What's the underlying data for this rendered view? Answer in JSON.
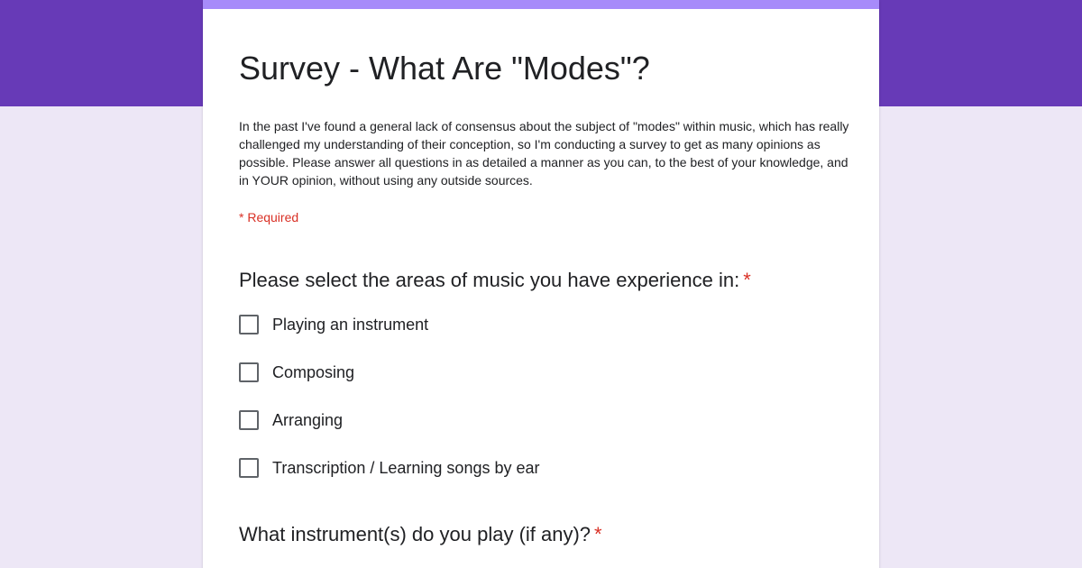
{
  "theme": {
    "header_color": "#673ab7",
    "accent_strip_color": "#a78bfa",
    "background_color": "#ede7f6",
    "required_color": "#d93025"
  },
  "form": {
    "title": "Survey - What Are \"Modes\"?",
    "description": "In the past I've found a general lack of consensus about the subject of \"modes\" within music, which has really challenged my understanding of their conception, so I'm conducting a survey to get as many opinions as possible. Please answer all questions in as detailed a manner as you can, to the best of your knowledge, and in YOUR opinion, without using any outside sources.",
    "required_note": "* Required"
  },
  "questions": [
    {
      "text": "Please select the areas of music you have experience in:",
      "required_marker": "*",
      "type": "checkbox",
      "options": [
        {
          "label": "Playing an instrument",
          "checked": false
        },
        {
          "label": "Composing",
          "checked": false
        },
        {
          "label": "Arranging",
          "checked": false
        },
        {
          "label": "Transcription / Learning songs by ear",
          "checked": false
        }
      ]
    },
    {
      "text": "What instrument(s) do you play (if any)?",
      "required_marker": "*"
    }
  ]
}
